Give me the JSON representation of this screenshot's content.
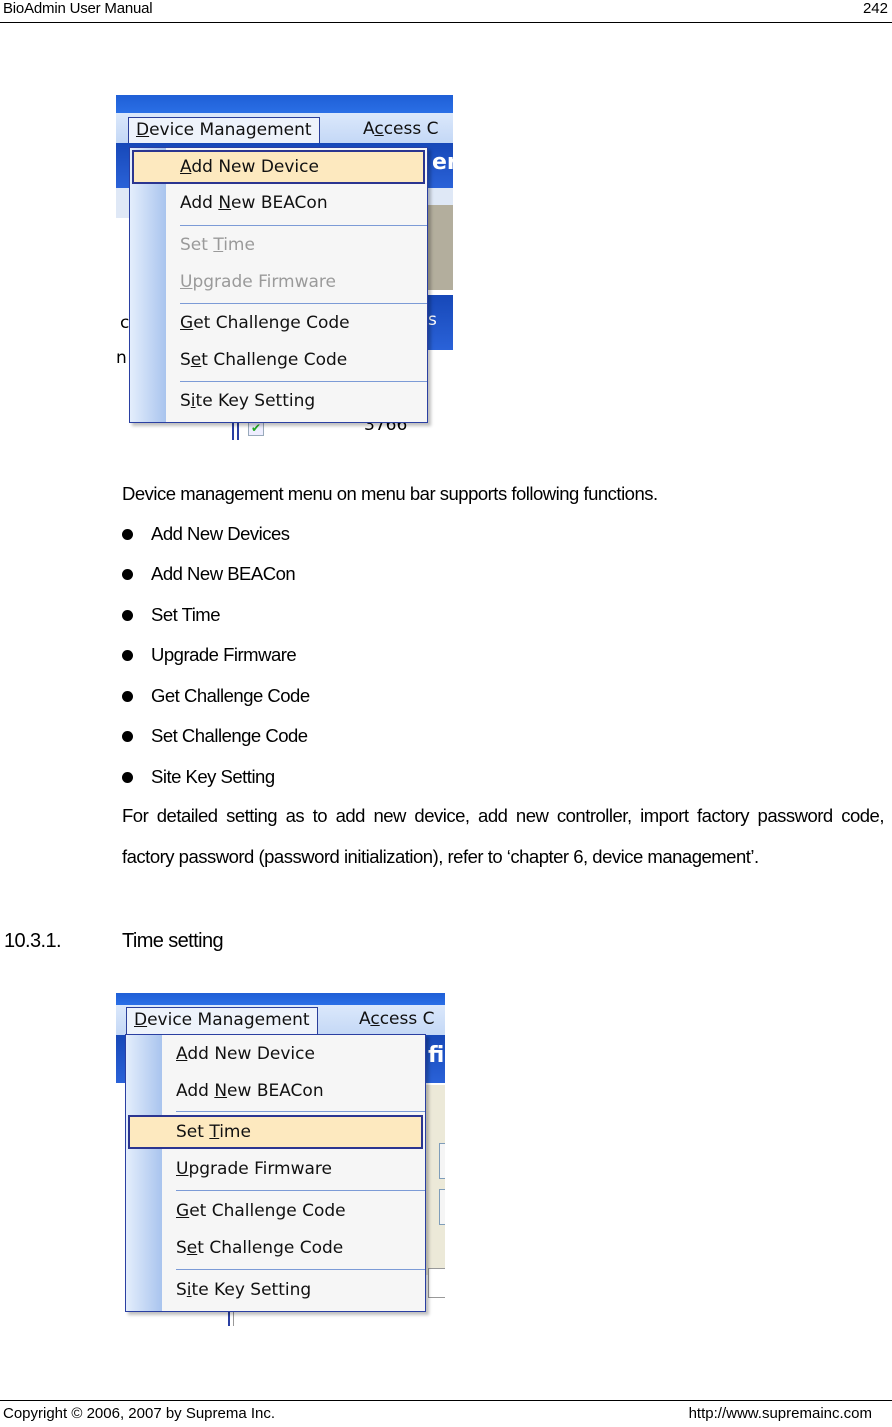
{
  "header": {
    "title": "BioAdmin  User  Manual",
    "page_number": "242"
  },
  "footer": {
    "copyright": "Copyright © 2006, 2007 by Suprema Inc.",
    "url": "http://www.supremainc.com"
  },
  "screenshot1": {
    "menubar": [
      {
        "label": "Device Management",
        "mnemonic": "D"
      },
      {
        "label": "Access C",
        "mnemonic": "c"
      }
    ],
    "menu_items": [
      {
        "label": "Add New Device",
        "state": "highlighted"
      },
      {
        "label": "Add New BEACon",
        "state": "enabled"
      },
      {
        "label": "Set Time",
        "state": "disabled"
      },
      {
        "label": "Upgrade Firmware",
        "state": "disabled"
      },
      {
        "label": "Get Challenge Code",
        "state": "enabled"
      },
      {
        "label": "Set Challenge Code",
        "state": "enabled"
      },
      {
        "label": "Site Key Setting",
        "state": "enabled"
      }
    ],
    "background_fragments": {
      "right_top": "er",
      "right_mid": "s",
      "left_a": "c",
      "left_b": "n",
      "row_value": "3766"
    }
  },
  "intro": "Device management menu on menu bar supports following functions.",
  "bullets": [
    "Add New Devices",
    "Add New BEACon",
    "Set Time",
    "Upgrade Firmware",
    "Get Challenge Code",
    "Set Challenge Code",
    "Site Key Setting"
  ],
  "detail_paragraph": "For detailed setting as to add new device, add new controller, import factory password code, factory password (password initialization), refer to ‘chapter 6, device management’.",
  "section": {
    "number": "10.3.1.",
    "title": "Time setting"
  },
  "screenshot2": {
    "menubar": [
      {
        "label": "Device Management",
        "mnemonic": "D"
      },
      {
        "label": "Access C",
        "mnemonic": "c"
      }
    ],
    "menu_items": [
      {
        "label": "Add New Device",
        "state": "enabled"
      },
      {
        "label": "Add New BEACon",
        "state": "enabled"
      },
      {
        "label": "Set Time",
        "state": "highlighted"
      },
      {
        "label": "Upgrade Firmware",
        "state": "enabled"
      },
      {
        "label": "Get Challenge Code",
        "state": "enabled"
      },
      {
        "label": "Set Challenge Code",
        "state": "enabled"
      },
      {
        "label": "Site Key Setting",
        "state": "enabled"
      }
    ],
    "background_fragments": {
      "right_top": "fi"
    }
  },
  "colors": {
    "highlight_bg": "#fde9bf",
    "highlight_border": "#2b3590",
    "menu_bg": "#f6f6f6",
    "titlebar_blue": "#2a6fe6"
  }
}
